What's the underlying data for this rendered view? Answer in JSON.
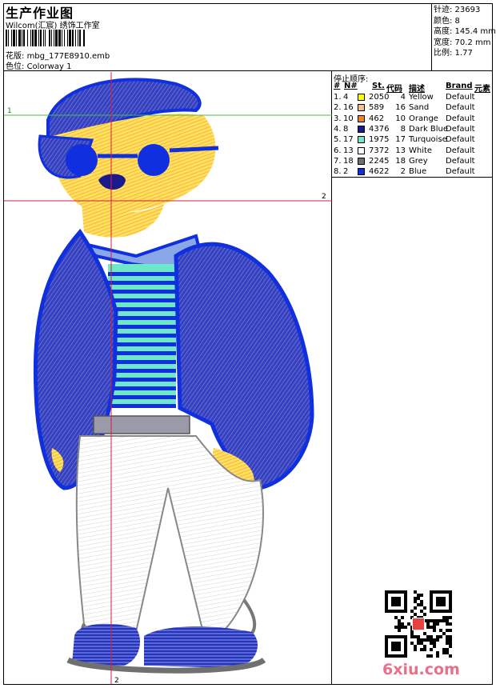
{
  "header": {
    "title": "生产作业图",
    "subtitle": "Wilcom(汇宸) 绣饰工作室",
    "design_file_label": "花版:",
    "design_file": "mbg_177E8910.emb",
    "colorway_label": "色位:",
    "colorway": "Colorway 1"
  },
  "stats": {
    "stitches": "针迹: 23693",
    "colors": "颜色: 8",
    "height": "高度: 145.4 mm",
    "width": "宽度: 70.2 mm",
    "ratio": "比例: 1.77"
  },
  "stop_sequence": {
    "title": "停止顺序:",
    "headers": {
      "hash": "#",
      "n": "N#",
      "st": "St.",
      "code": "代码",
      "desc": "描述",
      "brand": "Brand",
      "element": "元素"
    },
    "rows": [
      {
        "no": "1.",
        "n": "4",
        "st": "2050",
        "code": "4",
        "desc": "Yellow",
        "brand": "Default",
        "color": "#ffff00"
      },
      {
        "no": "2.",
        "n": "16",
        "st": "589",
        "code": "16",
        "desc": "Sand",
        "brand": "Default",
        "color": "#f6c08a"
      },
      {
        "no": "3.",
        "n": "10",
        "st": "462",
        "code": "10",
        "desc": "Orange",
        "brand": "Default",
        "color": "#f07f2a"
      },
      {
        "no": "4.",
        "n": "8",
        "st": "4376",
        "code": "8",
        "desc": "Dark Blue",
        "brand": "Default",
        "color": "#1a1a8c"
      },
      {
        "no": "5.",
        "n": "17",
        "st": "1975",
        "code": "17",
        "desc": "Turquoise",
        "brand": "Default",
        "color": "#6ee8c8"
      },
      {
        "no": "6.",
        "n": "13",
        "st": "7372",
        "code": "13",
        "desc": "White",
        "brand": "Default",
        "color": "#ffffff"
      },
      {
        "no": "7.",
        "n": "18",
        "st": "2245",
        "code": "18",
        "desc": "Grey",
        "brand": "Default",
        "color": "#707070"
      },
      {
        "no": "8.",
        "n": "2",
        "st": "4622",
        "code": "2",
        "desc": "Blue",
        "brand": "Default",
        "color": "#1030e0"
      }
    ]
  },
  "guides": {
    "h1": "1",
    "h2": "2",
    "v": "2"
  },
  "watermark": "6xiu.com"
}
